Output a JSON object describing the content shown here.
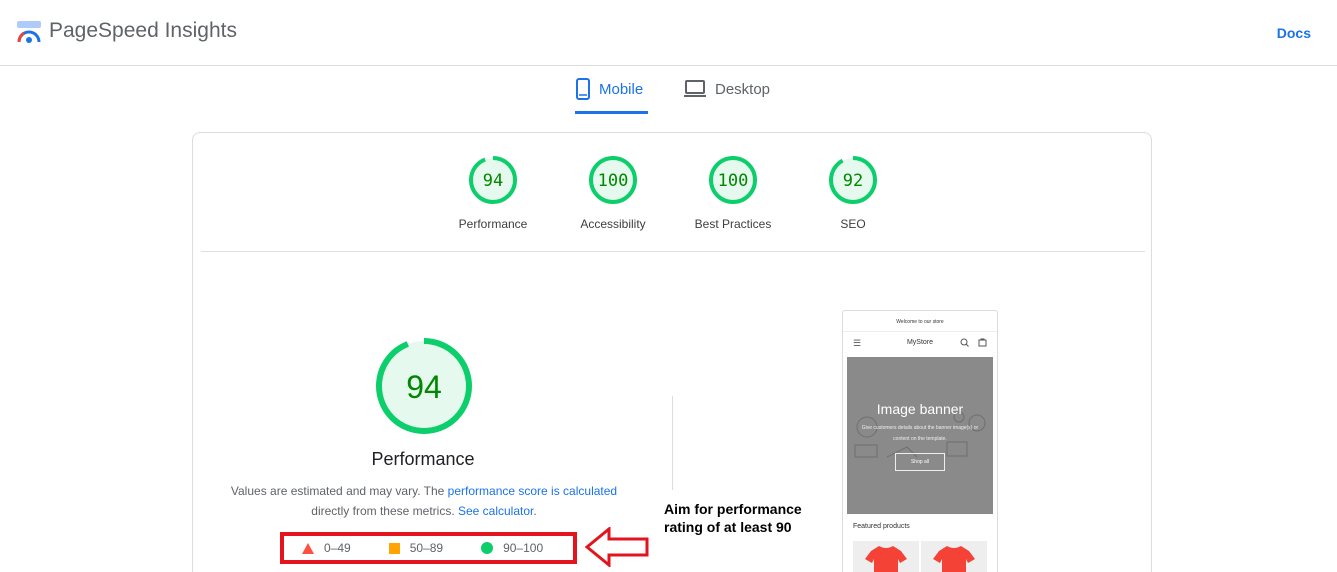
{
  "header": {
    "title": "PageSpeed Insights",
    "docs_link": "Docs"
  },
  "tabs": [
    {
      "label": "Mobile",
      "active": true
    },
    {
      "label": "Desktop",
      "active": false
    }
  ],
  "scores": [
    {
      "value": 94,
      "label": "Performance"
    },
    {
      "value": 100,
      "label": "Accessibility"
    },
    {
      "value": 100,
      "label": "Best Practices"
    },
    {
      "value": 92,
      "label": "SEO"
    }
  ],
  "performance": {
    "score": 94,
    "title": "Performance",
    "desc_prefix": "Values are estimated and may vary. The ",
    "desc_link": "performance score is calculated",
    "desc_middle": " directly from these metrics. ",
    "calc_link": "See calculator",
    "desc_suffix": "."
  },
  "legend": {
    "poor": "0–49",
    "average": "50–89",
    "good": "90–100"
  },
  "annotation": "Aim for performance rating of at least 90",
  "screenshot": {
    "announcement": "Welcome to our store",
    "store_name": "MyStore",
    "banner_title": "Image banner",
    "banner_subtitle": "Give customers details about the banner image(s) or content on the template.",
    "banner_button": "Shop all",
    "featured": "Featured products"
  },
  "colors": {
    "good": "#0cce6b",
    "good_text": "#008800",
    "average": "#ffa400",
    "poor": "#ff4e42",
    "accent": "#1a73e8",
    "annotation_red": "#e3141c"
  }
}
